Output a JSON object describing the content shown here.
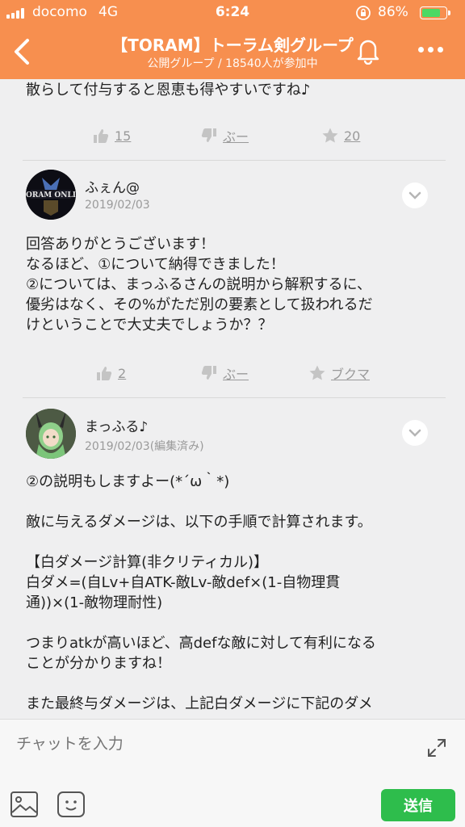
{
  "status_bar": {
    "carrier": "docomo",
    "network": "4G",
    "time": "6:24",
    "battery_pct": "86%",
    "battery_level": 0.86
  },
  "header": {
    "title": "【TORAM】トーラム剣グループ",
    "subtitle": "公開グループ / 18540人が参加中",
    "back_icon": "chevron-left-icon",
    "bell_icon": "bell-icon",
    "more_icon": "more-icon"
  },
  "posts": [
    {
      "text": "散らして付与すると恩恵も得やすいですね♪",
      "reactions": {
        "like": "15",
        "dislike": "ぶー",
        "bookmark": "20"
      }
    },
    {
      "user": "ふぇん@",
      "date": "2019/02/03",
      "text": "回答ありがとうございます！\nなるほど、①について納得できました！\n②については、まっふるさんの説明から解釈するに、\n優劣はなく、その%がただ別の要素として扱われるだ\nけということで大丈夫でしょうか？？",
      "reactions": {
        "like": "2",
        "dislike": "ぶー",
        "bookmark": "ブクマ"
      }
    },
    {
      "user": "まっふる♪",
      "date": "2019/02/03(編集済み)",
      "text": "②の説明もしますよー(*´ω｀*)\n\n敵に与えるダメージは、以下の手順で計算されます。\n\n【白ダメージ計算(非クリティカル)】\n白ダメ=(自Lv+自ATK-敵Lv-敵def×(1-自物理貫\n通))×(1-敵物理耐性)\n\nつまりatkが高いほど、高defな敵に対して有利になる\nことが分かりますね！\n\nまた最終与ダメージは、上記白ダメージに下記のダメ"
    }
  ],
  "composer": {
    "placeholder": "チャットを入力",
    "send_label": "送信"
  },
  "colors": {
    "header": "#f78f4f",
    "send": "#2ebd4c",
    "background": "#efeff0"
  }
}
